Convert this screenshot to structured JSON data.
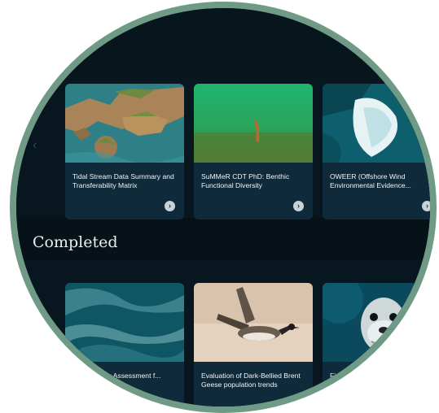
{
  "carousel_prev_icon": "chevron-left-icon",
  "row1_cards": [
    {
      "title": "Tidal Stream Data Summary and Transferability Matrix",
      "image": "rocky-coastline-aerial"
    },
    {
      "title": "SuMMeR CDT PhD: Benthic Functional Diversity",
      "image": "green-seabed-sea-pen"
    },
    {
      "title": "OWEER (Offshore Wind Environmental Evidence...",
      "image": "breaking-waves-aerial"
    }
  ],
  "completed_section": {
    "title": "Completed",
    "cards": [
      {
        "title": "D: Fronts for Assessment f...",
        "image": "ocean-surface-aerial"
      },
      {
        "title": "Evaluation of Dark-Bellied Brent Geese population trends",
        "image": "brent-goose-flying"
      },
      {
        "title": "Fisheries ag",
        "image": "grey-seal-underwater"
      }
    ]
  }
}
